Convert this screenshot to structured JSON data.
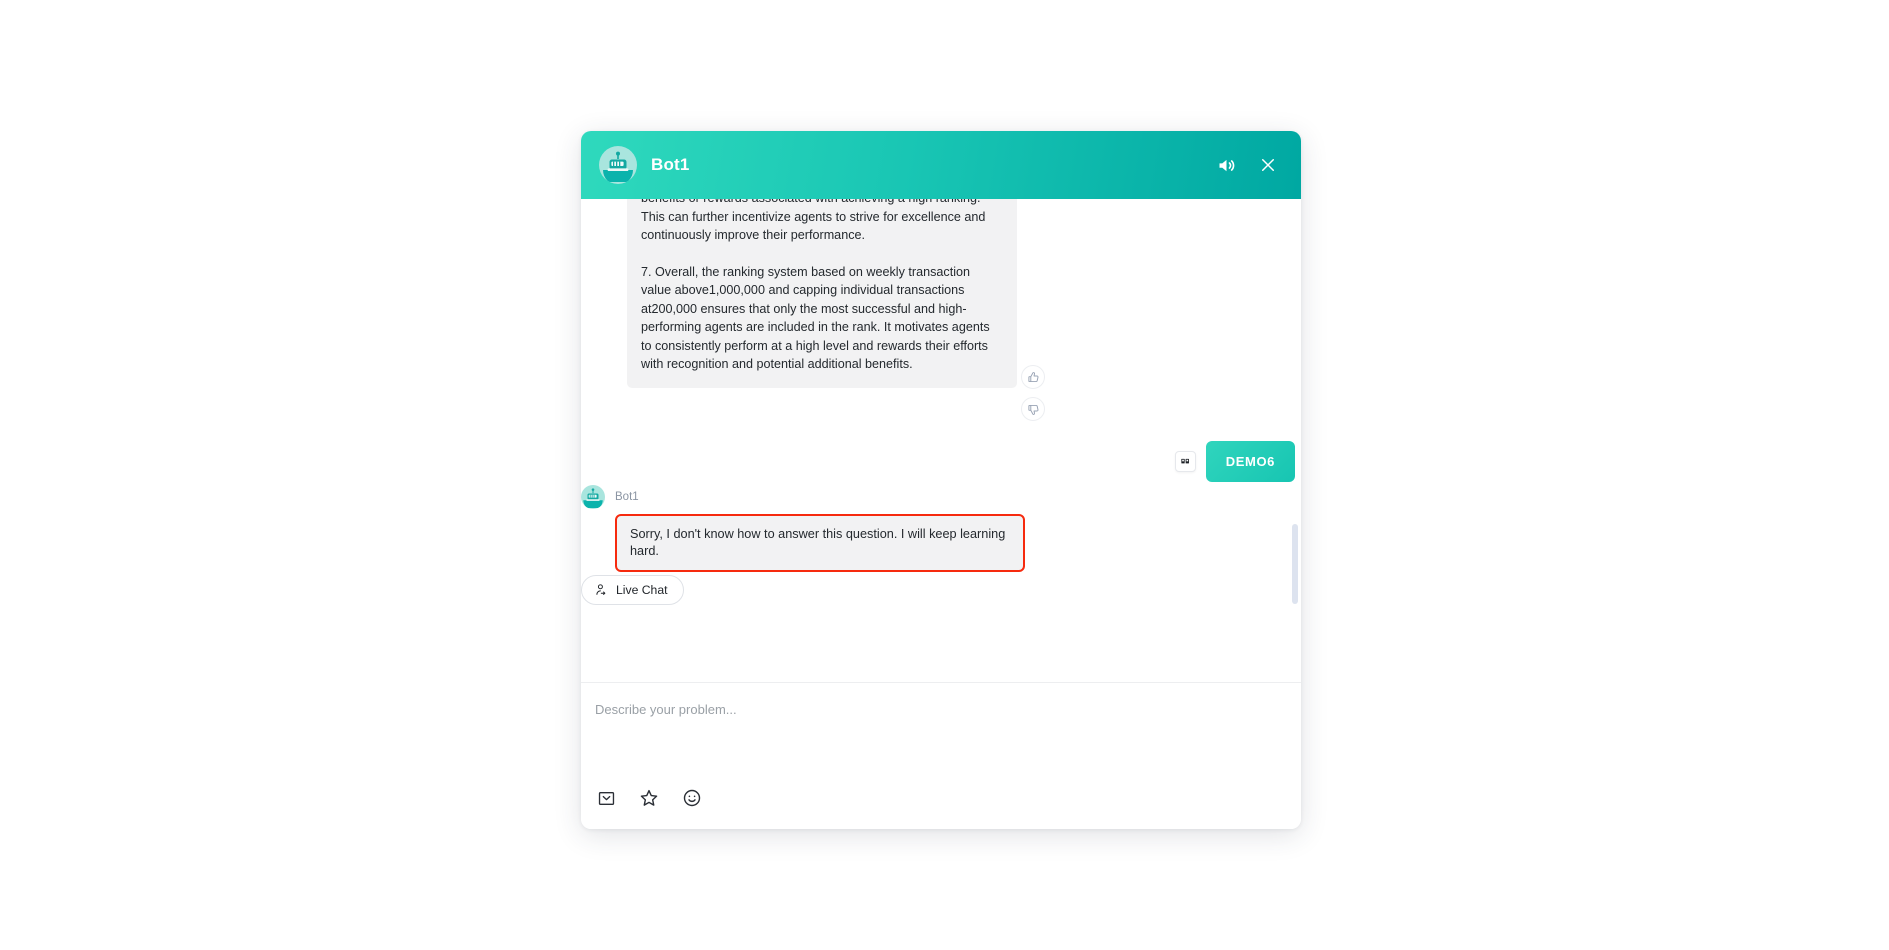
{
  "widget": {
    "header": {
      "title": "Bot1",
      "avatar_icon": "robot-avatar-icon",
      "volume_icon": "volume-speaker-icon",
      "close_icon": "close-x-icon",
      "gradient_from": "#2fd9bd",
      "gradient_to": "#00a8a2"
    },
    "messages": [
      {
        "role": "bot",
        "paragraphs": [
          "benefits or rewards associated with achieving a high ranking. This can further incentivize agents to strive for excellence and continuously improve their performance.",
          "7. Overall, the ranking system based on weekly transaction value above1,000,000 and capping individual transactions at200,000 ensures that only the most successful and high-performing agents are included in the rank. It motivates agents to consistently perform at a high level and rewards their efforts with recognition and potential additional benefits."
        ],
        "feedback": {
          "thumbs_up_icon": "thumbs-up-icon",
          "thumbs_down_icon": "thumbs-down-icon"
        }
      },
      {
        "role": "user",
        "text": "DEMO6",
        "quote_icon": "quote-copy-icon",
        "bubble_color": "#19c8b4"
      },
      {
        "role": "bot",
        "sender_name": "Bot1",
        "text": "Sorry, I don't know how to answer this question. I will keep learning hard.",
        "highlight_color": "#f62a0e"
      }
    ],
    "live_chat": {
      "label": "Live Chat",
      "icon": "person-transfer-icon"
    },
    "composer": {
      "placeholder": "Describe your problem...",
      "value": "",
      "tools": [
        {
          "name": "envelope-icon",
          "label": "Email"
        },
        {
          "name": "star-icon",
          "label": "Favorite"
        },
        {
          "name": "emoji-smiley-icon",
          "label": "Emoji"
        }
      ]
    },
    "scrollbar": {
      "thumb_color": "#dde3ef"
    }
  }
}
